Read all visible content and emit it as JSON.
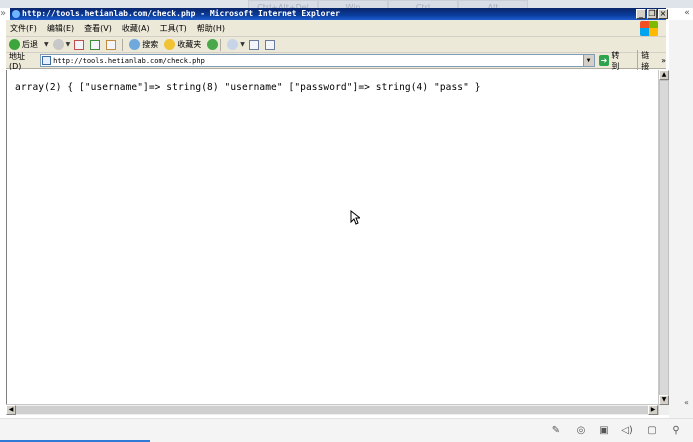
{
  "window": {
    "title": "http://tools.hetianlab.com/check.php - Microsoft Internet Explorer",
    "ghost_tabs": [
      "Ctrl+Alt+Del",
      "Win",
      "Ctrl",
      "Alt"
    ]
  },
  "menubar": {
    "items": [
      "文件(F)",
      "编辑(E)",
      "查看(V)",
      "收藏(A)",
      "工具(T)",
      "帮助(H)"
    ]
  },
  "toolbar": {
    "back_label": "后退",
    "search_label": "搜索",
    "favorites_label": "收藏夹"
  },
  "address": {
    "label": "地址(D)",
    "url": "http://tools.hetianlab.com/check.php",
    "go_label": "转到",
    "links_label": "链接"
  },
  "content": {
    "text": "array(2) { [\"username\"]=> string(8) \"username\" [\"password\"]=> string(4) \"pass\" }"
  },
  "colors": {
    "titlebar": "#0a246a",
    "chrome": "#ece9d8"
  }
}
